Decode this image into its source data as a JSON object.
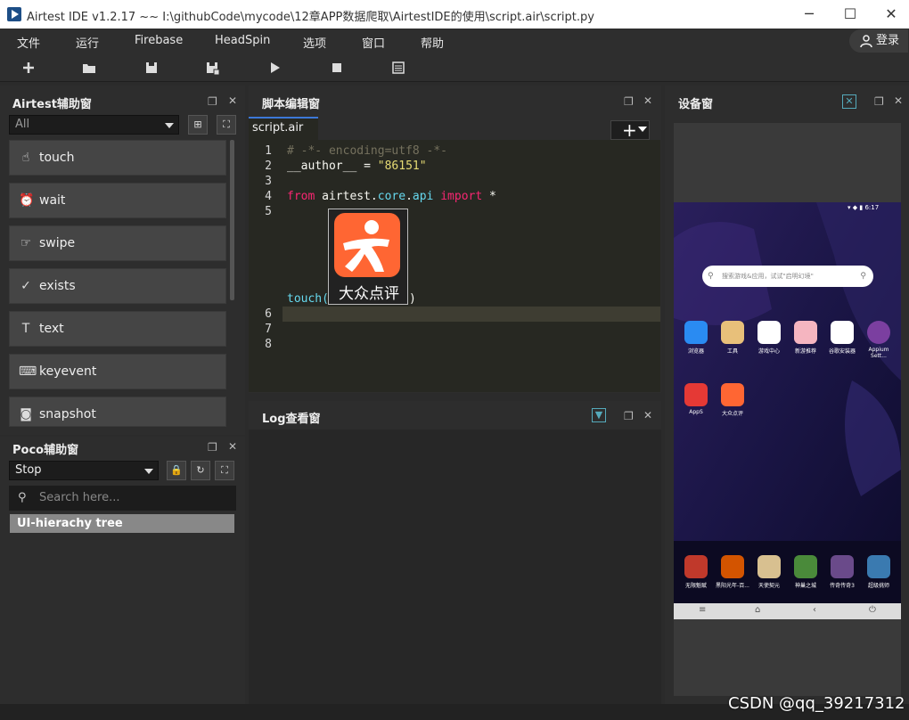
{
  "window": {
    "title": "Airtest IDE v1.2.17 ~~ I:\\githubCode\\mycode\\12章APP数据爬取\\AirtestIDE的使用\\script.air\\script.py",
    "min": "─",
    "max": "☐",
    "close": "✕"
  },
  "menu": [
    "文件",
    "运行",
    "Firebase",
    "HeadSpin",
    "选项",
    "窗口",
    "帮助"
  ],
  "login": "登录",
  "toolbar_icons": [
    "plus-icon",
    "folder-open-icon",
    "save-icon",
    "save-all-icon",
    "play-icon",
    "stop-icon",
    "log-view-icon"
  ],
  "airtest_panel": {
    "title": "Airtest辅助窗",
    "filter_value": "All",
    "apis": [
      "touch",
      "wait",
      "swipe",
      "exists",
      "text",
      "keyevent",
      "snapshot"
    ]
  },
  "poco_panel": {
    "title": "Poco辅助窗",
    "mode_value": "Stop",
    "search_placeholder": "Search here...",
    "tree_header": "UI-hierachy tree"
  },
  "script_panel": {
    "title": "脚本编辑窗",
    "tab": "script.air",
    "line_numbers": [
      "1",
      "2",
      "3",
      "4",
      "5",
      "6",
      "7",
      "8"
    ],
    "code": {
      "l1": "# -*- encoding=utf8 -*-",
      "l2a": "__author__",
      "l2b": " = ",
      "l2c": "\"86151\"",
      "l4a": "from",
      "l4b": " airtest.",
      "l4c": "core",
      "l4d": ".",
      "l4e": "api",
      "l4f": " ",
      "l4g": "import",
      "l4h": " *",
      "touch_fn": "touch(",
      "touch_close": ")"
    },
    "thumbnail_caption": "大众点评"
  },
  "log_panel": {
    "title": "Log查看窗"
  },
  "device_panel": {
    "title": "设备窗",
    "status_time": "6:17",
    "search_hint": "搜索游戏&应用，试试\"启明幻境\"",
    "apps_row1": [
      "浏览器",
      "工具",
      "游戏中心",
      "新游推荐",
      "谷歌安装器",
      "Appium Sett..."
    ],
    "apps_row2": [
      "AppS",
      "大众点评"
    ],
    "apps_row3": [
      "无限魁赋",
      "黑阳光年-百...",
      "天使契元",
      "神巢之城",
      "传奇传奇3",
      "超级挑师"
    ],
    "nav": [
      "≡",
      "⌂",
      "‹",
      "⏻"
    ]
  },
  "watermark": "CSDN @qq_39217312",
  "colors": {
    "bg": "#2b2b2b",
    "editor_bg": "#272822",
    "keyword": "#f92672",
    "string": "#e6db74",
    "comment": "#75715e",
    "function": "#66d9ef",
    "accent_orange": "#ff6633"
  }
}
